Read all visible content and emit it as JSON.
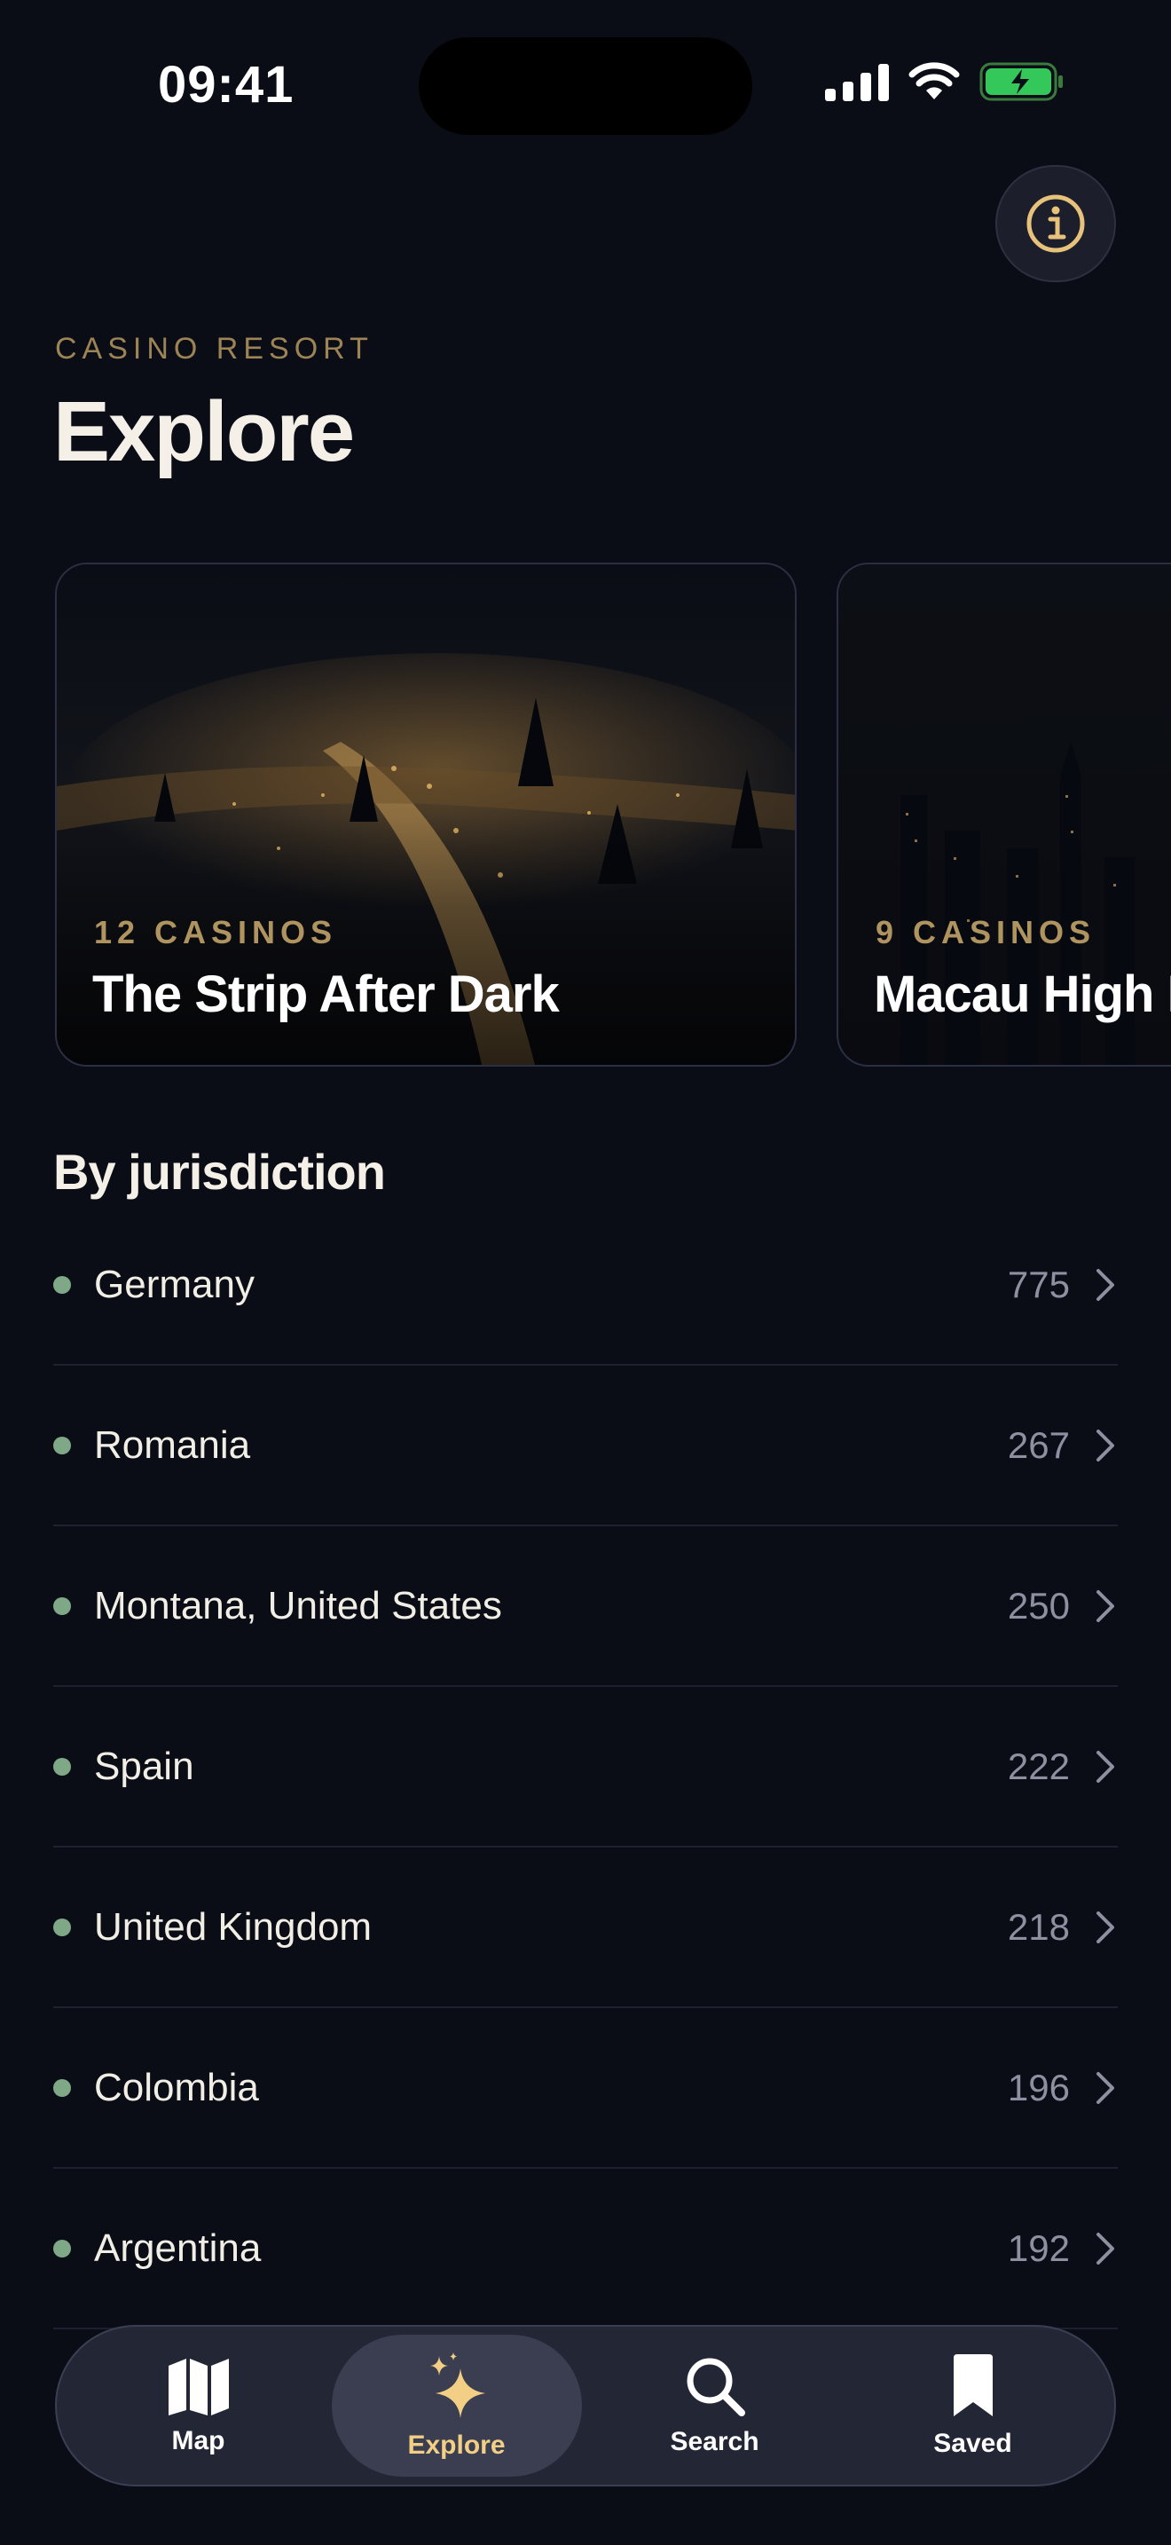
{
  "status_bar": {
    "time": "09:41"
  },
  "header": {
    "eyebrow": "CASINO RESORT",
    "title": "Explore"
  },
  "cards": [
    {
      "count": "12 CASINOS",
      "title": "The Strip After Dark"
    },
    {
      "count": "9 CASINOS",
      "title": "Macau High Rollers"
    }
  ],
  "jurisdictions": {
    "title": "By jurisdiction",
    "items": [
      {
        "name": "Germany",
        "count": "775"
      },
      {
        "name": "Romania",
        "count": "267"
      },
      {
        "name": "Montana, United States",
        "count": "250"
      },
      {
        "name": "Spain",
        "count": "222"
      },
      {
        "name": "United Kingdom",
        "count": "218"
      },
      {
        "name": "Colombia",
        "count": "196"
      },
      {
        "name": "Argentina",
        "count": "192"
      }
    ]
  },
  "tabs": [
    {
      "label": "Map",
      "icon": "map-icon"
    },
    {
      "label": "Explore",
      "icon": "sparkles-icon",
      "active": true
    },
    {
      "label": "Search",
      "icon": "search-icon"
    },
    {
      "label": "Saved",
      "icon": "bookmark-icon"
    }
  ],
  "colors": {
    "accent": "#f3cf86",
    "gold_text": "#9c8455",
    "dot": "#7fa886",
    "background": "#0b0d16"
  }
}
